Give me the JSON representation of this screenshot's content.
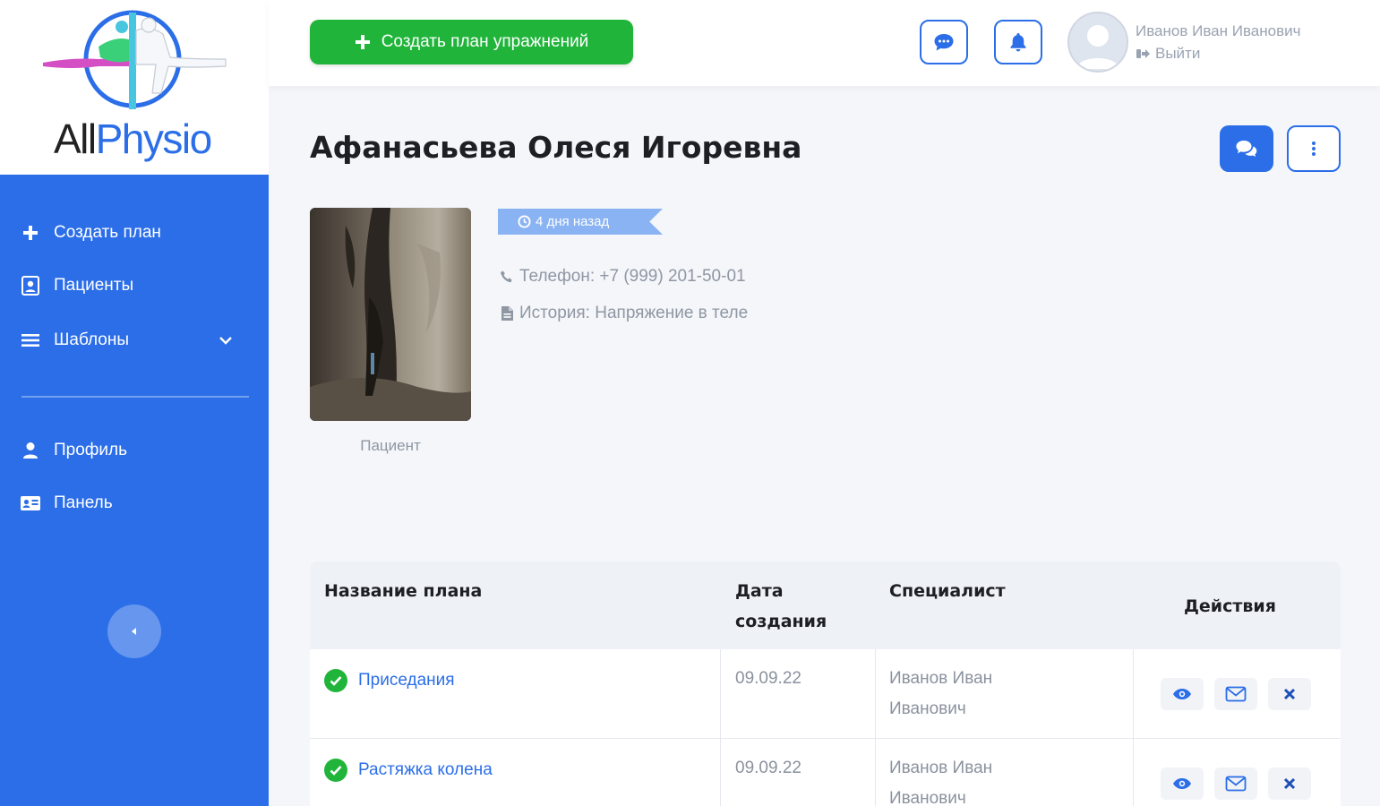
{
  "brand": {
    "name_part1": "All",
    "name_part2": "Physio"
  },
  "sidebar": {
    "items": [
      {
        "label": "Создать план",
        "icon": "plus-icon"
      },
      {
        "label": "Пациенты",
        "icon": "patients-icon"
      },
      {
        "label": "Шаблоны",
        "icon": "list-icon"
      },
      {
        "label": "Профиль",
        "icon": "user-icon"
      },
      {
        "label": "Панель",
        "icon": "id-card-icon"
      }
    ],
    "collapse_icon": "chevron-left-icon"
  },
  "header": {
    "create_button_label": "Создать план упражнений",
    "user_name": "Иванов Иван Иванович",
    "logout_label": "Выйти"
  },
  "patient": {
    "full_name": "Афанасьева Олеся Игоревна",
    "photo_caption": "Пациент",
    "time_badge": "4 дня назад",
    "phone_line": "Телефон: +7 (999) 201-50-01",
    "history_line": "История: Напряжение в теле"
  },
  "table": {
    "headers": {
      "plan_name": "Название плана",
      "created_line1": "Дата",
      "created_line2": "создания",
      "specialist": "Специалист",
      "actions": "Действия"
    },
    "rows": [
      {
        "plan": "Приседания",
        "date": "09.09.22",
        "specialist_line1": "Иванов Иван",
        "specialist_line2": "Иванович"
      },
      {
        "plan": "Растяжка колена",
        "date": "09.09.22",
        "specialist_line1": "Иванов Иван",
        "specialist_line2": "Иванович"
      }
    ]
  },
  "colors": {
    "primary": "#2b6ee8",
    "success": "#20b53a",
    "badge": "#8ab3f3"
  }
}
